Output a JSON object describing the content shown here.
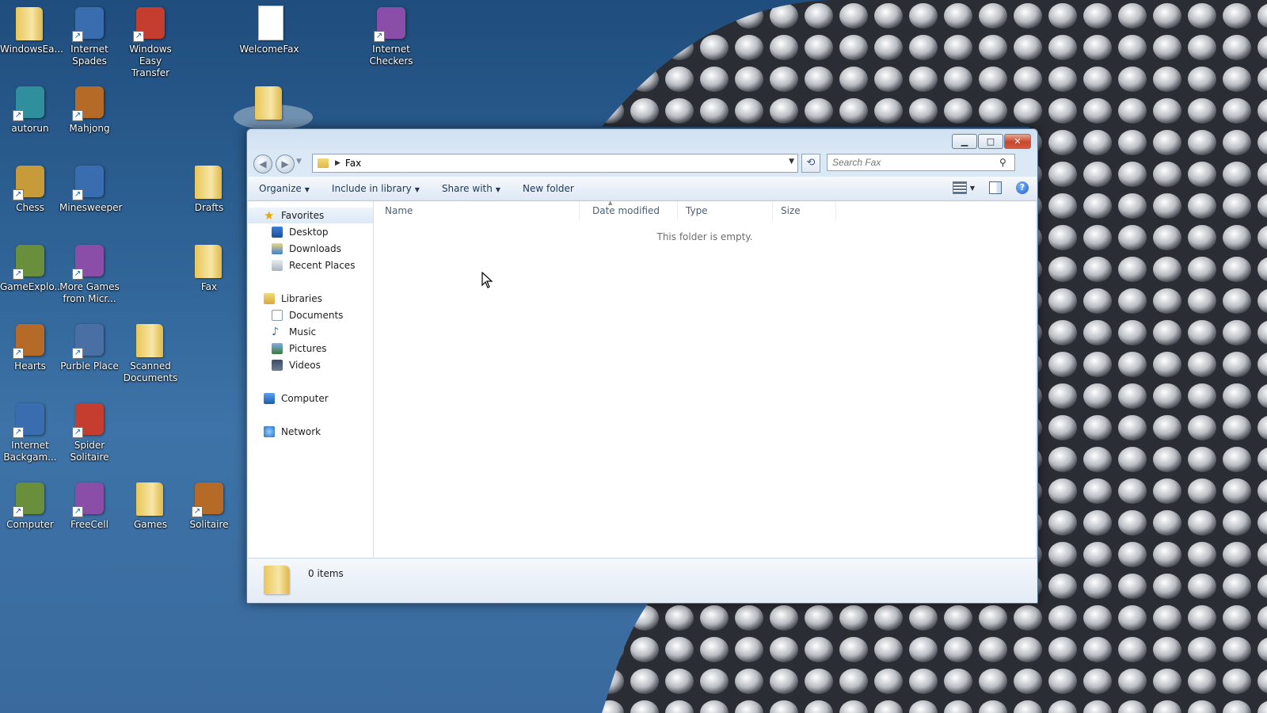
{
  "desktop": {
    "icons": [
      {
        "label": "WindowsEa...",
        "icon": "folder-icon"
      },
      {
        "label": "Internet Spades",
        "icon": "spades-game-icon"
      },
      {
        "label": "Windows Easy Transfer",
        "icon": "easy-transfer-icon"
      },
      {
        "label": "WelcomeFax",
        "icon": "document-icon"
      },
      {
        "label": "Internet Checkers",
        "icon": "checkers-game-icon"
      },
      {
        "label": "autorun",
        "icon": "autorun-icon"
      },
      {
        "label": "Mahjong",
        "icon": "mahjong-icon"
      },
      {
        "label": "",
        "icon": "folder-icon"
      },
      {
        "label": "Chess",
        "icon": "chess-icon"
      },
      {
        "label": "Minesweeper",
        "icon": "minesweeper-icon"
      },
      {
        "label": "Drafts",
        "icon": "folder-icon"
      },
      {
        "label": "GameExplo...",
        "icon": "game-explorer-icon"
      },
      {
        "label": "More Games from Micr...",
        "icon": "more-games-icon"
      },
      {
        "label": "Fax",
        "icon": "folder-icon"
      },
      {
        "label": "Hearts",
        "icon": "hearts-icon"
      },
      {
        "label": "Purble Place",
        "icon": "purble-place-icon"
      },
      {
        "label": "Scanned Documents",
        "icon": "scanned-documents-icon"
      },
      {
        "label": "Internet Backgam...",
        "icon": "backgammon-icon"
      },
      {
        "label": "Spider Solitaire",
        "icon": "spider-solitaire-icon"
      },
      {
        "label": "Computer",
        "icon": "computer-icon"
      },
      {
        "label": "FreeCell",
        "icon": "freecell-icon"
      },
      {
        "label": "Games",
        "icon": "folder-icon"
      },
      {
        "label": "Solitaire",
        "icon": "solitaire-icon"
      }
    ]
  },
  "explorer": {
    "breadcrumb": "Fax",
    "search_placeholder": "Search Fax",
    "toolbar": {
      "organize": "Organize",
      "include_in_library": "Include in library",
      "share_with": "Share with",
      "new_folder": "New folder"
    },
    "nav": {
      "favorites": "Favorites",
      "desktop": "Desktop",
      "downloads": "Downloads",
      "recent_places": "Recent Places",
      "libraries": "Libraries",
      "documents": "Documents",
      "music": "Music",
      "pictures": "Pictures",
      "videos": "Videos",
      "computer": "Computer",
      "network": "Network"
    },
    "columns": {
      "name": "Name",
      "date_modified": "Date modified",
      "type": "Type",
      "size": "Size"
    },
    "empty_message": "This folder is empty.",
    "status": "0 items"
  },
  "colors": {
    "accent": "#1e395b",
    "close_button": "#c7452c",
    "desktop_sky": "#2f6396"
  }
}
